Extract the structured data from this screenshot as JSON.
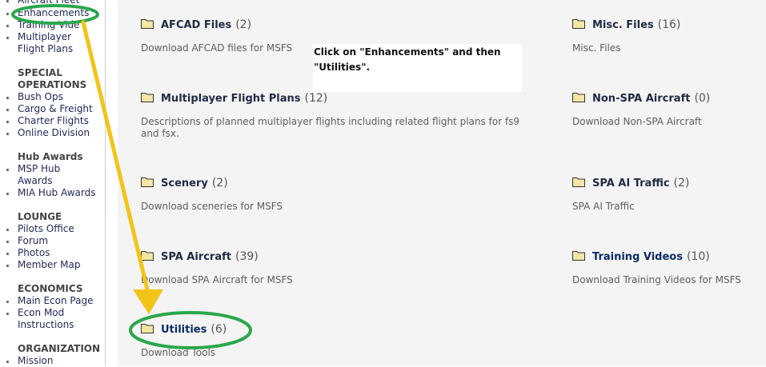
{
  "sidebar": {
    "items_top": [
      {
        "label": "Aircraft Fleet"
      },
      {
        "label": "Enhancements"
      },
      {
        "label": "Training Vide"
      },
      {
        "label": "Multiplayer",
        "cont": "Flight Plans"
      }
    ],
    "sections": [
      {
        "title": "SPECIAL",
        "title2": "OPERATIONS",
        "items": [
          {
            "label": "Bush Ops"
          },
          {
            "label": "Cargo & Freight"
          },
          {
            "label": "Charter Flights"
          },
          {
            "label": "Online Division"
          }
        ]
      },
      {
        "title": "Hub Awards",
        "items": [
          {
            "label": "MSP Hub",
            "cont": "Awards"
          },
          {
            "label": "MIA Hub Awards"
          }
        ]
      },
      {
        "title": "LOUNGE",
        "items": [
          {
            "label": "Pilots Office"
          },
          {
            "label": "Forum"
          },
          {
            "label": "Photos"
          },
          {
            "label": "Member Map"
          }
        ]
      },
      {
        "title": "ECONOMICS",
        "items": [
          {
            "label": "Main Econ Page"
          },
          {
            "label": "Econ Mod",
            "cont": "Instructions"
          }
        ]
      },
      {
        "title": "ORGANIZATION",
        "items": [
          {
            "label": "Mission"
          }
        ]
      }
    ]
  },
  "categories": [
    {
      "name": "AFCAD Files",
      "count": "(2)",
      "desc": "Download AFCAD files for MSFS"
    },
    {
      "name": "Misc. Files",
      "count": "(16)",
      "desc": "Misc. Files"
    },
    {
      "name": "Multiplayer Flight Plans",
      "count": "(12)",
      "desc": "Descriptions of planned multiplayer flights including related flight plans for fs9",
      "desc2": "and fsx."
    },
    {
      "name": "Non-SPA Aircraft",
      "count": "(0)",
      "desc": "Download Non-SPA Aircraft"
    },
    {
      "name": "Scenery",
      "count": "(2)",
      "desc": "Download sceneries for MSFS"
    },
    {
      "name": "SPA AI Traffic",
      "count": "(2)",
      "desc": "SPA AI Traffic"
    },
    {
      "name": "SPA Aircraft",
      "count": "(39)",
      "desc": "Download SPA Aircraft for MSFS"
    },
    {
      "name": "Training Videos",
      "count": "(10)",
      "desc": "Download Training Videos for MSFS"
    },
    {
      "name": "Utilities",
      "count": "(6)",
      "desc": "Download Tools"
    }
  ],
  "instruction": {
    "line1": "Click on \"Enhancements\" and then",
    "line2": "\"Utilities\"."
  },
  "colors": {
    "annotation_circle": "#2aa84a",
    "annotation_arrow": "#f2c418",
    "folder": "#f5e6a3"
  }
}
